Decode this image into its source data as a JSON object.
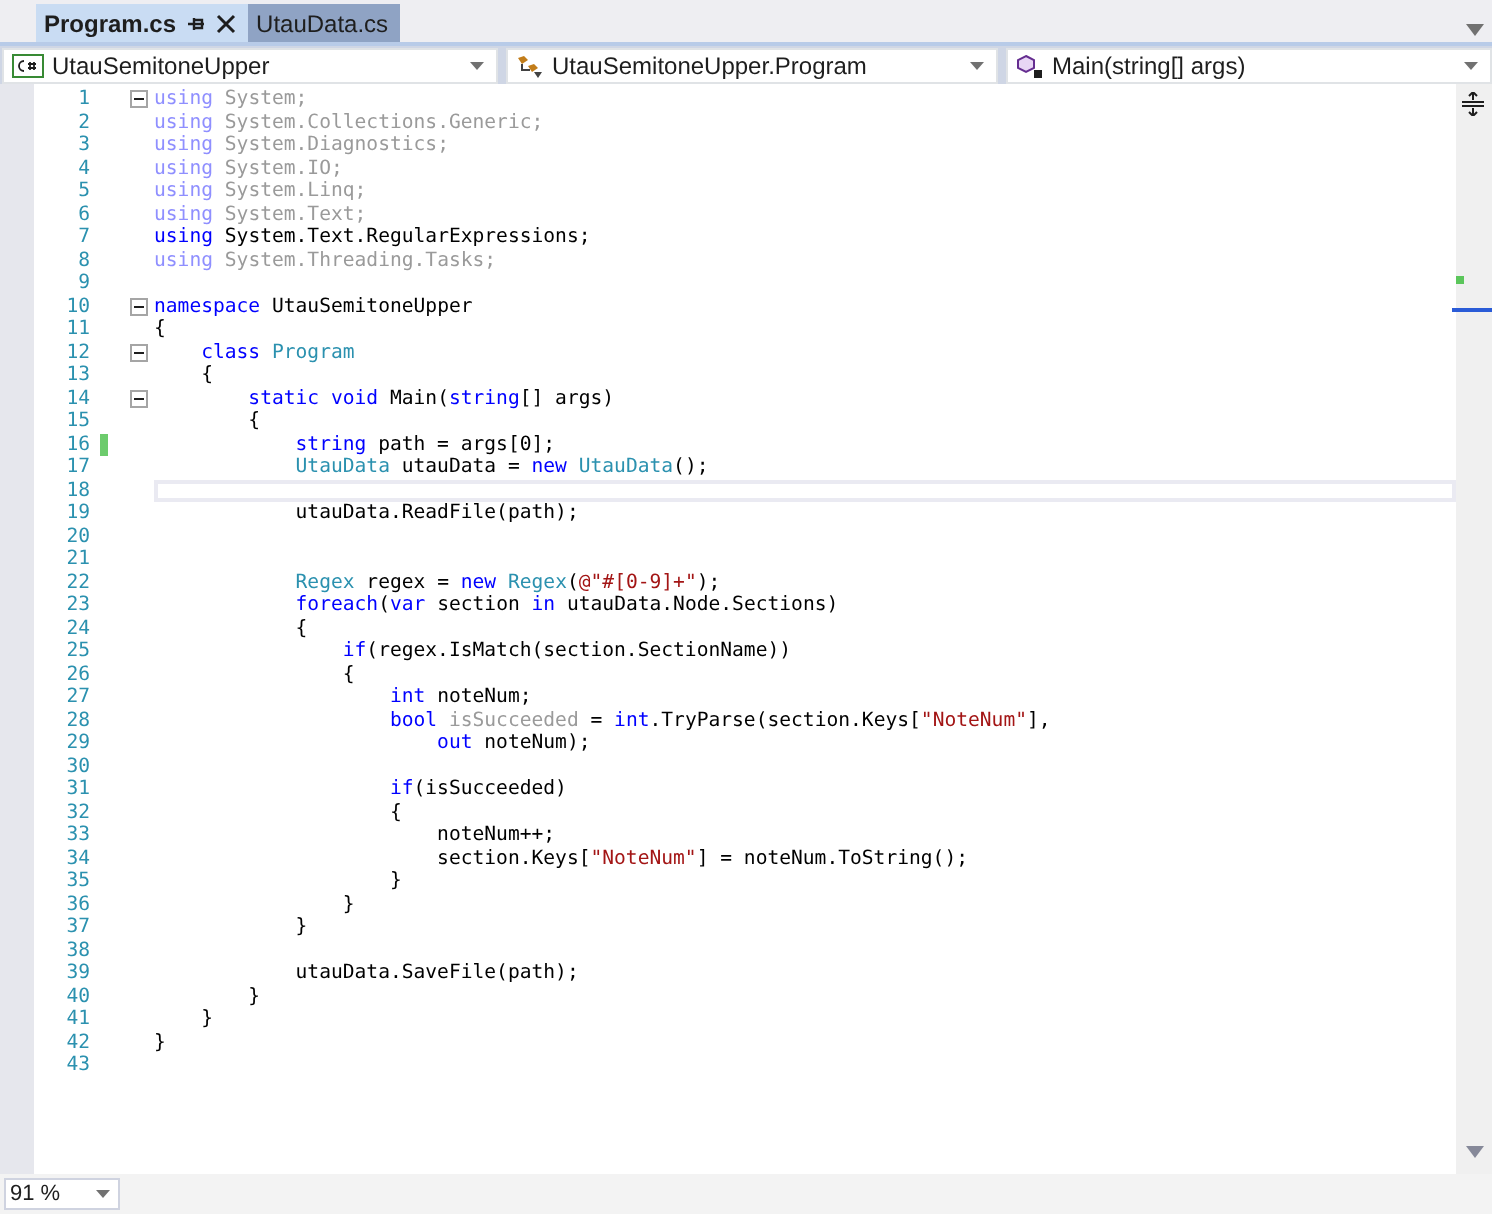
{
  "tabs": [
    {
      "label": "Program.cs",
      "selected": true,
      "pinned": true,
      "closable": true
    },
    {
      "label": "UtauData.cs",
      "selected": false,
      "pinned": false,
      "closable": false
    }
  ],
  "navigation": [
    {
      "kind": "project",
      "label": "UtauSemitoneUpper"
    },
    {
      "kind": "class",
      "label": "UtauSemitoneUpper.Program"
    },
    {
      "kind": "method",
      "label": "Main(string[] args)"
    }
  ],
  "lines": [
    {
      "number": "1",
      "foldable": true,
      "changed": false,
      "current": false,
      "tokens": [
        {
          "text": "using",
          "kind": "faded-keyword"
        },
        {
          "text": " System;",
          "kind": "faded"
        }
      ]
    },
    {
      "number": "2",
      "foldable": false,
      "changed": false,
      "current": false,
      "tokens": [
        {
          "text": "using",
          "kind": "faded-keyword"
        },
        {
          "text": " System.Collections.Generic;",
          "kind": "faded"
        }
      ]
    },
    {
      "number": "3",
      "foldable": false,
      "changed": false,
      "current": false,
      "tokens": [
        {
          "text": "using",
          "kind": "faded-keyword"
        },
        {
          "text": " System.Diagnostics;",
          "kind": "faded"
        }
      ]
    },
    {
      "number": "4",
      "foldable": false,
      "changed": false,
      "current": false,
      "tokens": [
        {
          "text": "using",
          "kind": "faded-keyword"
        },
        {
          "text": " System.IO;",
          "kind": "faded"
        }
      ]
    },
    {
      "number": "5",
      "foldable": false,
      "changed": false,
      "current": false,
      "tokens": [
        {
          "text": "using",
          "kind": "faded-keyword"
        },
        {
          "text": " System.Linq;",
          "kind": "faded"
        }
      ]
    },
    {
      "number": "6",
      "foldable": false,
      "changed": false,
      "current": false,
      "tokens": [
        {
          "text": "using",
          "kind": "faded-keyword"
        },
        {
          "text": " System.Text;",
          "kind": "faded"
        }
      ]
    },
    {
      "number": "7",
      "foldable": false,
      "changed": false,
      "current": false,
      "tokens": [
        {
          "text": "using",
          "kind": "keyword"
        },
        {
          "text": " System.Text.RegularExpressions;",
          "kind": "plain"
        }
      ]
    },
    {
      "number": "8",
      "foldable": false,
      "changed": false,
      "current": false,
      "tokens": [
        {
          "text": "using",
          "kind": "faded-keyword"
        },
        {
          "text": " System.Threading.Tasks;",
          "kind": "faded"
        }
      ]
    },
    {
      "number": "9",
      "foldable": false,
      "changed": false,
      "current": false
    },
    {
      "number": "10",
      "foldable": true,
      "changed": false,
      "current": false,
      "tokens": [
        {
          "text": "namespace",
          "kind": "keyword"
        },
        {
          "text": " UtauSemitoneUpper",
          "kind": "plain"
        }
      ]
    },
    {
      "number": "11",
      "foldable": false,
      "changed": false,
      "current": false,
      "tokens": [
        {
          "text": "{",
          "kind": "plain"
        }
      ]
    },
    {
      "number": "12",
      "foldable": true,
      "changed": false,
      "current": false,
      "tokens": [
        {
          "text": "    class",
          "kind": "keyword"
        },
        {
          "text": " Program",
          "kind": "type"
        }
      ]
    },
    {
      "number": "13",
      "foldable": false,
      "changed": false,
      "current": false,
      "tokens": [
        {
          "text": "    {",
          "kind": "plain"
        }
      ]
    },
    {
      "number": "14",
      "foldable": true,
      "changed": false,
      "current": false,
      "tokens": [
        {
          "text": "        static void",
          "kind": "keyword"
        },
        {
          "text": " Main(",
          "kind": "plain"
        },
        {
          "text": "string",
          "kind": "keyword"
        },
        {
          "text": "[] args)",
          "kind": "plain"
        }
      ]
    },
    {
      "number": "15",
      "foldable": false,
      "changed": false,
      "current": false,
      "tokens": [
        {
          "text": "        {",
          "kind": "plain"
        }
      ]
    },
    {
      "number": "16",
      "foldable": false,
      "changed": true,
      "current": false,
      "tokens": [
        {
          "text": "            string",
          "kind": "keyword"
        },
        {
          "text": " path = args[0];",
          "kind": "plain"
        }
      ]
    },
    {
      "number": "17",
      "foldable": false,
      "changed": false,
      "current": false,
      "tokens": [
        {
          "text": "            UtauData",
          "kind": "type"
        },
        {
          "text": " utauData = ",
          "kind": "plain"
        },
        {
          "text": "new",
          "kind": "keyword"
        },
        {
          "text": " UtauData",
          "kind": "type"
        },
        {
          "text": "();",
          "kind": "plain"
        }
      ]
    },
    {
      "number": "18",
      "foldable": false,
      "changed": false,
      "current": true
    },
    {
      "number": "19",
      "foldable": false,
      "changed": false,
      "current": false,
      "tokens": [
        {
          "text": "            utauData.ReadFile(path);",
          "kind": "plain"
        }
      ]
    },
    {
      "number": "20",
      "foldable": false,
      "changed": false,
      "current": false
    },
    {
      "number": "21",
      "foldable": false,
      "changed": false,
      "current": false
    },
    {
      "number": "22",
      "foldable": false,
      "changed": false,
      "current": false,
      "tokens": [
        {
          "text": "            Regex",
          "kind": "type"
        },
        {
          "text": " regex = ",
          "kind": "plain"
        },
        {
          "text": "new",
          "kind": "keyword"
        },
        {
          "text": " Regex",
          "kind": "type"
        },
        {
          "text": "(",
          "kind": "plain"
        },
        {
          "text": "@\"#[0-9]+\"",
          "kind": "string"
        },
        {
          "text": ");",
          "kind": "plain"
        }
      ]
    },
    {
      "number": "23",
      "foldable": false,
      "changed": false,
      "current": false,
      "tokens": [
        {
          "text": "            foreach",
          "kind": "keyword"
        },
        {
          "text": "(",
          "kind": "plain"
        },
        {
          "text": "var",
          "kind": "keyword"
        },
        {
          "text": " section ",
          "kind": "plain"
        },
        {
          "text": "in",
          "kind": "keyword"
        },
        {
          "text": " utauData.Node.Sections)",
          "kind": "plain"
        }
      ]
    },
    {
      "number": "24",
      "foldable": false,
      "changed": false,
      "current": false,
      "tokens": [
        {
          "text": "            {",
          "kind": "plain"
        }
      ]
    },
    {
      "number": "25",
      "foldable": false,
      "changed": false,
      "current": false,
      "tokens": [
        {
          "text": "                if",
          "kind": "keyword"
        },
        {
          "text": "(regex.IsMatch(section.SectionName))",
          "kind": "plain"
        }
      ]
    },
    {
      "number": "26",
      "foldable": false,
      "changed": false,
      "current": false,
      "tokens": [
        {
          "text": "                {",
          "kind": "plain"
        }
      ]
    },
    {
      "number": "27",
      "foldable": false,
      "changed": false,
      "current": false,
      "tokens": [
        {
          "text": "                    int",
          "kind": "keyword"
        },
        {
          "text": " noteNum;",
          "kind": "plain"
        }
      ]
    },
    {
      "number": "28",
      "foldable": false,
      "changed": false,
      "current": false,
      "tokens": [
        {
          "text": "                    bool",
          "kind": "keyword"
        },
        {
          "text": " isSucceeded",
          "kind": "faded"
        },
        {
          "text": " = ",
          "kind": "plain"
        },
        {
          "text": "int",
          "kind": "keyword"
        },
        {
          "text": ".TryParse(section.Keys[",
          "kind": "plain"
        },
        {
          "text": "\"NoteNum\"",
          "kind": "string"
        },
        {
          "text": "],",
          "kind": "plain"
        }
      ]
    },
    {
      "number": "29",
      "foldable": false,
      "changed": false,
      "current": false,
      "tokens": [
        {
          "text": "                        out",
          "kind": "keyword"
        },
        {
          "text": " noteNum);",
          "kind": "plain"
        }
      ]
    },
    {
      "number": "30",
      "foldable": false,
      "changed": false,
      "current": false
    },
    {
      "number": "31",
      "foldable": false,
      "changed": false,
      "current": false,
      "tokens": [
        {
          "text": "                    if",
          "kind": "keyword"
        },
        {
          "text": "(isSucceeded)",
          "kind": "plain"
        }
      ]
    },
    {
      "number": "32",
      "foldable": false,
      "changed": false,
      "current": false,
      "tokens": [
        {
          "text": "                    {",
          "kind": "plain"
        }
      ]
    },
    {
      "number": "33",
      "foldable": false,
      "changed": false,
      "current": false,
      "tokens": [
        {
          "text": "                        noteNum++;",
          "kind": "plain"
        }
      ]
    },
    {
      "number": "34",
      "foldable": false,
      "changed": false,
      "current": false,
      "tokens": [
        {
          "text": "                        section.Keys[",
          "kind": "plain"
        },
        {
          "text": "\"NoteNum\"",
          "kind": "string"
        },
        {
          "text": "] = noteNum.ToString();",
          "kind": "plain"
        }
      ]
    },
    {
      "number": "35",
      "foldable": false,
      "changed": false,
      "current": false,
      "tokens": [
        {
          "text": "                    }",
          "kind": "plain"
        }
      ]
    },
    {
      "number": "36",
      "foldable": false,
      "changed": false,
      "current": false,
      "tokens": [
        {
          "text": "                }",
          "kind": "plain"
        }
      ]
    },
    {
      "number": "37",
      "foldable": false,
      "changed": false,
      "current": false,
      "tokens": [
        {
          "text": "            }",
          "kind": "plain"
        }
      ]
    },
    {
      "number": "38",
      "foldable": false,
      "changed": false,
      "current": false
    },
    {
      "number": "39",
      "foldable": false,
      "changed": false,
      "current": false,
      "tokens": [
        {
          "text": "            utauData.SaveFile(path);",
          "kind": "plain"
        }
      ]
    },
    {
      "number": "40",
      "foldable": false,
      "changed": false,
      "current": false,
      "tokens": [
        {
          "text": "        }",
          "kind": "plain"
        }
      ]
    },
    {
      "number": "41",
      "foldable": false,
      "changed": false,
      "current": false,
      "tokens": [
        {
          "text": "    }",
          "kind": "plain"
        }
      ]
    },
    {
      "number": "42",
      "foldable": false,
      "changed": false,
      "current": false,
      "tokens": [
        {
          "text": "}",
          "kind": "plain"
        }
      ]
    },
    {
      "number": "43",
      "foldable": false,
      "changed": false,
      "current": false
    }
  ],
  "zoom": {
    "value": "91 %"
  }
}
